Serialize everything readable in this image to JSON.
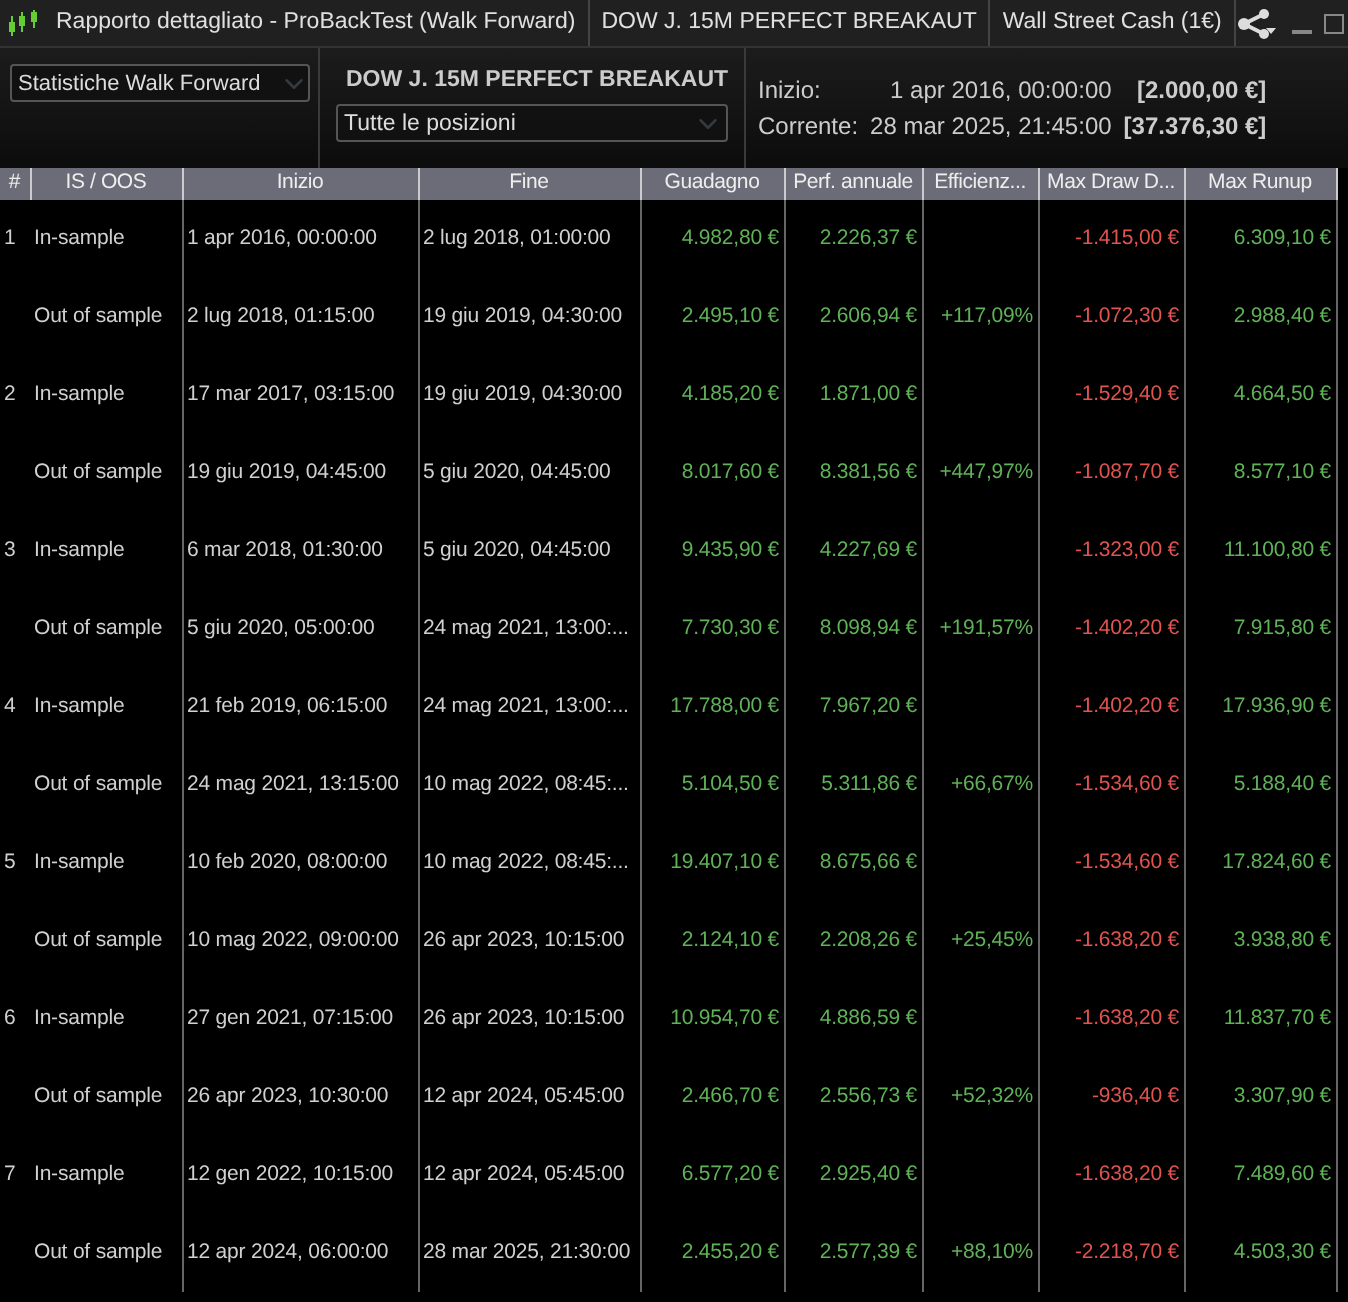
{
  "title_bar": {
    "tabs": [
      "Rapporto dettagliato - ProBackTest (Walk Forward)",
      "DOW J. 15M PERFECT BREAKAUT",
      "Wall Street Cash (1€)"
    ]
  },
  "toolbar": {
    "view_select": "Statistiche Walk Forward",
    "strategy_name": "DOW J. 15M PERFECT BREAKAUT",
    "positions_select": "Tutte le posizioni",
    "info": [
      {
        "label": "Inizio:",
        "date": "1 apr 2016, 00:00:00",
        "amount": "[2.000,00 €]"
      },
      {
        "label": "Corrente:",
        "date": "28 mar 2025, 21:45:00",
        "amount": "[37.376,30 €]"
      }
    ]
  },
  "table": {
    "columns": [
      {
        "label": "#",
        "kind": "text"
      },
      {
        "label": "IS / OOS",
        "kind": "text"
      },
      {
        "label": "Inizio",
        "kind": "text"
      },
      {
        "label": "Fine",
        "kind": "text"
      },
      {
        "label": "Guadagno",
        "kind": "gain"
      },
      {
        "label": "Perf. annuale",
        "kind": "gain"
      },
      {
        "label": "Efficienz...",
        "kind": "gain"
      },
      {
        "label": "Max Draw D...",
        "kind": "loss"
      },
      {
        "label": "Max Runup",
        "kind": "gain"
      }
    ],
    "rows": [
      [
        "1",
        "In-sample",
        "1 apr 2016, 00:00:00",
        "2 lug 2018, 01:00:00",
        "4.982,80 €",
        "2.226,37 €",
        null,
        "-1.415,00 €",
        "6.309,10 €"
      ],
      [
        null,
        "Out of sample",
        "2 lug 2018, 01:15:00",
        "19 giu 2019, 04:30:00",
        "2.495,10 €",
        "2.606,94 €",
        "+117,09%",
        "-1.072,30 €",
        "2.988,40 €"
      ],
      [
        "2",
        "In-sample",
        "17 mar 2017, 03:15:00",
        "19 giu 2019, 04:30:00",
        "4.185,20 €",
        "1.871,00 €",
        null,
        "-1.529,40 €",
        "4.664,50 €"
      ],
      [
        null,
        "Out of sample",
        "19 giu 2019, 04:45:00",
        "5 giu 2020, 04:45:00",
        "8.017,60 €",
        "8.381,56 €",
        "+447,97%",
        "-1.087,70 €",
        "8.577,10 €"
      ],
      [
        "3",
        "In-sample",
        "6 mar 2018, 01:30:00",
        "5 giu 2020, 04:45:00",
        "9.435,90 €",
        "4.227,69 €",
        null,
        "-1.323,00 €",
        "11.100,80 €"
      ],
      [
        null,
        "Out of sample",
        "5 giu 2020, 05:00:00",
        "24 mag 2021, 13:00:...",
        "7.730,30 €",
        "8.098,94 €",
        "+191,57%",
        "-1.402,20 €",
        "7.915,80 €"
      ],
      [
        "4",
        "In-sample",
        "21 feb 2019, 06:15:00",
        "24 mag 2021, 13:00:...",
        "17.788,00 €",
        "7.967,20 €",
        null,
        "-1.402,20 €",
        "17.936,90 €"
      ],
      [
        null,
        "Out of sample",
        "24 mag 2021, 13:15:00",
        "10 mag 2022, 08:45:...",
        "5.104,50 €",
        "5.311,86 €",
        "+66,67%",
        "-1.534,60 €",
        "5.188,40 €"
      ],
      [
        "5",
        "In-sample",
        "10 feb 2020, 08:00:00",
        "10 mag 2022, 08:45:...",
        "19.407,10 €",
        "8.675,66 €",
        null,
        "-1.534,60 €",
        "17.824,60 €"
      ],
      [
        null,
        "Out of sample",
        "10 mag 2022, 09:00:00",
        "26 apr 2023, 10:15:00",
        "2.124,10 €",
        "2.208,26 €",
        "+25,45%",
        "-1.638,20 €",
        "3.938,80 €"
      ],
      [
        "6",
        "In-sample",
        "27 gen 2021, 07:15:00",
        "26 apr 2023, 10:15:00",
        "10.954,70 €",
        "4.886,59 €",
        null,
        "-1.638,20 €",
        "11.837,70 €"
      ],
      [
        null,
        "Out of sample",
        "26 apr 2023, 10:30:00",
        "12 apr 2024, 05:45:00",
        "2.466,70 €",
        "2.556,73 €",
        "+52,32%",
        "-936,40 €",
        "3.307,90 €"
      ],
      [
        "7",
        "In-sample",
        "12 gen 2022, 10:15:00",
        "12 apr 2024, 05:45:00",
        "6.577,20 €",
        "2.925,40 €",
        null,
        "-1.638,20 €",
        "7.489,60 €"
      ],
      [
        null,
        "Out of sample",
        "12 apr 2024, 06:00:00",
        "28 mar 2025, 21:30:00",
        "2.455,20 €",
        "2.577,39 €",
        "+88,10%",
        "-2.218,70 €",
        "4.503,30 €"
      ]
    ]
  }
}
